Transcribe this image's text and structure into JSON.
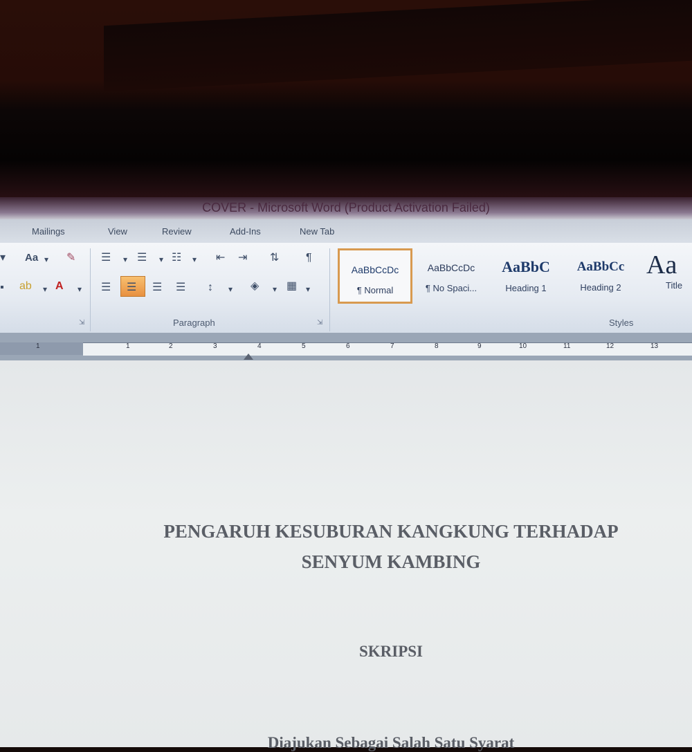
{
  "window": {
    "title": "COVER - Microsoft Word (Product Activation Failed)"
  },
  "ribbon_tabs": [
    "Mailings",
    "View",
    "Review",
    "Add-Ins",
    "New Tab"
  ],
  "ribbon": {
    "font_group": {
      "change_case_label": "Aa"
    },
    "paragraph_group": {
      "label": "Paragraph"
    },
    "styles_group": {
      "label": "Styles",
      "styles": [
        {
          "sample": "AaBbCcDc",
          "name": "¶ Normal",
          "selected": true
        },
        {
          "sample": "AaBbCcDc",
          "name": "¶ No Spaci...",
          "selected": false
        },
        {
          "sample": "AaBbC",
          "name": "Heading 1",
          "selected": false
        },
        {
          "sample": "AaBbCc",
          "name": "Heading 2",
          "selected": false
        },
        {
          "sample": "Aa",
          "name": "Title",
          "selected": false
        }
      ]
    }
  },
  "ruler": {
    "numbers": [
      "1",
      "1",
      "2",
      "3",
      "4",
      "5",
      "6",
      "7",
      "8",
      "9",
      "10",
      "11",
      "12",
      "13"
    ]
  },
  "document": {
    "title_line1": "PENGARUH KESUBURAN KANGKUNG TERHADAP",
    "title_line2": "SENYUM KAMBING",
    "type": "SKRIPSI",
    "subtitle_line1": "Diajukan Sebagai Salah Satu Syarat"
  }
}
